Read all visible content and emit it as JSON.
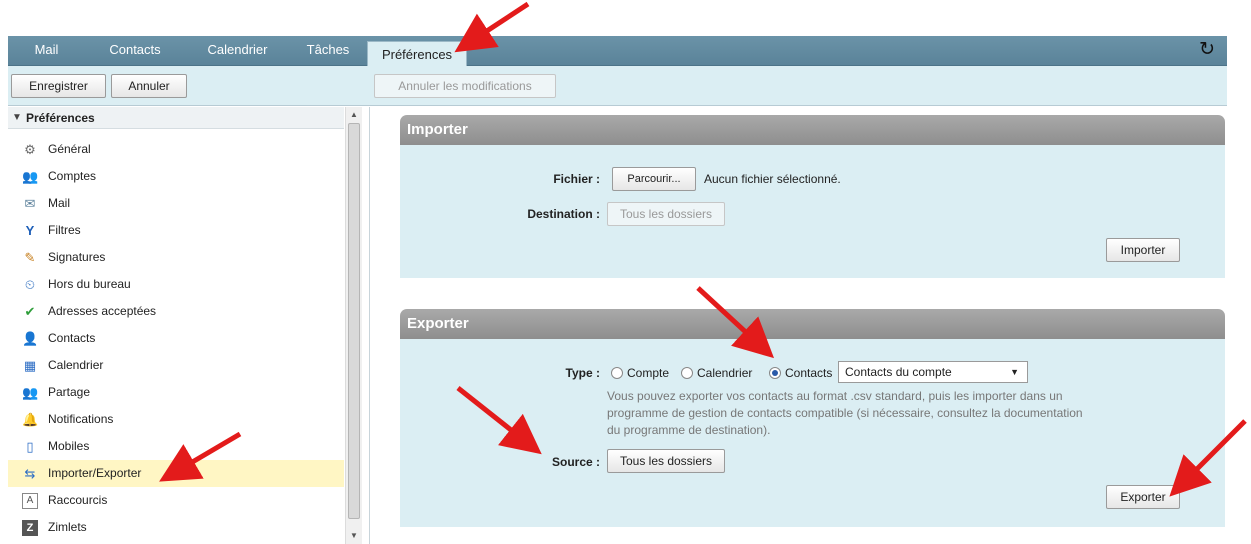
{
  "tabs": [
    {
      "label": "Mail"
    },
    {
      "label": "Contacts"
    },
    {
      "label": "Calendrier"
    },
    {
      "label": "Tâches"
    },
    {
      "label": "Préférences"
    }
  ],
  "refresh_icon": "refresh-icon",
  "toolbar": {
    "save_label": "Enregistrer",
    "cancel_label": "Annuler",
    "undo_label": "Annuler les modifications"
  },
  "sidebar": {
    "heading": "Préférences",
    "items": [
      {
        "label": "Général",
        "icon": "gear-icon"
      },
      {
        "label": "Comptes",
        "icon": "accounts-icon"
      },
      {
        "label": "Mail",
        "icon": "envelope-icon"
      },
      {
        "label": "Filtres",
        "icon": "filter-icon"
      },
      {
        "label": "Signatures",
        "icon": "signature-icon"
      },
      {
        "label": "Hors du bureau",
        "icon": "out-of-office-icon"
      },
      {
        "label": "Adresses acceptées",
        "icon": "shield-check-icon"
      },
      {
        "label": "Contacts",
        "icon": "person-icon"
      },
      {
        "label": "Calendrier",
        "icon": "calendar-icon"
      },
      {
        "label": "Partage",
        "icon": "sharing-icon"
      },
      {
        "label": "Notifications",
        "icon": "bell-icon"
      },
      {
        "label": "Mobiles",
        "icon": "mobile-icon"
      },
      {
        "label": "Importer/Exporter",
        "icon": "import-export-icon"
      },
      {
        "label": "Raccourcis",
        "icon": "keyboard-icon"
      },
      {
        "label": "Zimlets",
        "icon": "zimlet-icon"
      }
    ]
  },
  "import": {
    "title": "Importer",
    "file_label": "Fichier :",
    "browse_label": "Parcourir...",
    "no_file_text": "Aucun fichier sélectionné.",
    "destination_label": "Destination :",
    "destination_value": "Tous les dossiers",
    "submit_label": "Importer"
  },
  "export": {
    "title": "Exporter",
    "type_label": "Type :",
    "radio_account": "Compte",
    "radio_calendar": "Calendrier",
    "radio_contacts": "Contacts",
    "selected_type": "Contacts",
    "format_value": "Contacts du compte",
    "help_lines": [
      "Vous pouvez exporter vos contacts au format .csv standard, puis les importer dans un",
      "programme de gestion de contacts compatible (si nécessaire, consultez la documentation",
      "du programme de destination)."
    ],
    "source_label": "Source :",
    "source_value": "Tous les dossiers",
    "submit_label": "Exporter"
  },
  "colors": {
    "tabbar": "#5a8399",
    "panel_bg": "#dbeef3",
    "panel_header": "#8e8e8e",
    "selection": "#fff6c4",
    "annotation_arrow": "#e31b1b"
  }
}
